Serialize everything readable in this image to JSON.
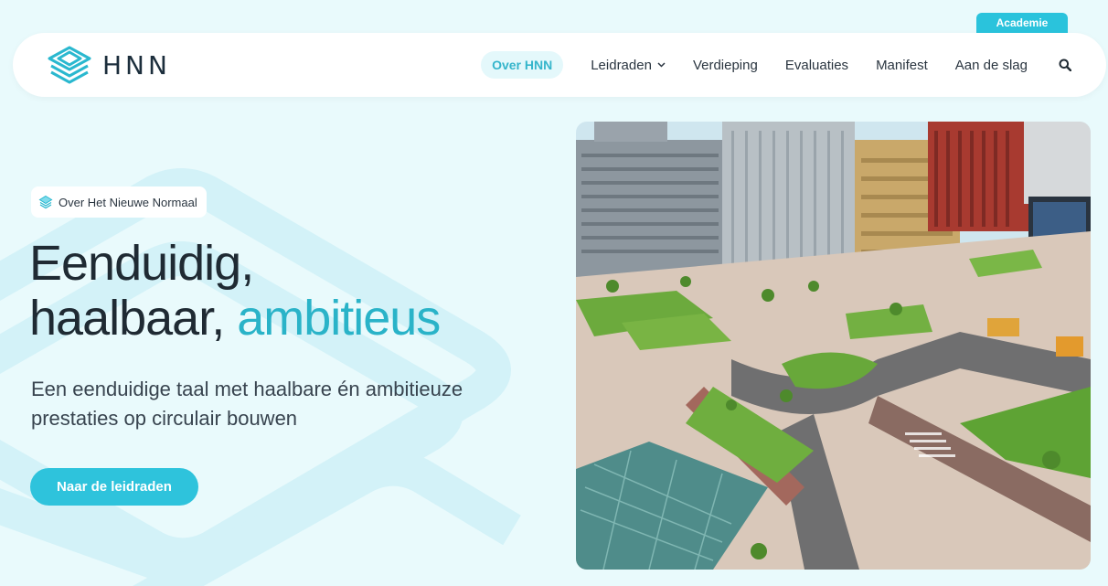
{
  "academie_tab": {
    "label": "Academie"
  },
  "logo": {
    "text": "HNN",
    "icon": "layers-logo-icon"
  },
  "nav": {
    "items": [
      {
        "label": "Over HNN",
        "active": true
      },
      {
        "label": "Leidraden",
        "has_dropdown": true
      },
      {
        "label": "Verdieping"
      },
      {
        "label": "Evaluaties"
      },
      {
        "label": "Manifest"
      },
      {
        "label": "Aan de slag"
      }
    ],
    "search_icon": "search-icon"
  },
  "hero": {
    "badge": "Over Het Nieuwe Normaal",
    "headline_line1": "Eenduidig,",
    "headline_line2_start": "haalbaar, ",
    "headline_line2_accent": "ambitieus",
    "subtitle": "Een eenduidige taal met haalbare én ambitieuze prestaties op circulair bouwen",
    "cta_label": "Naar de leidraden"
  },
  "colors": {
    "accent": "#2ec3dc",
    "background": "#e9fafc",
    "text_dark": "#1f2a33",
    "headline_accent": "#2ab3c8"
  }
}
